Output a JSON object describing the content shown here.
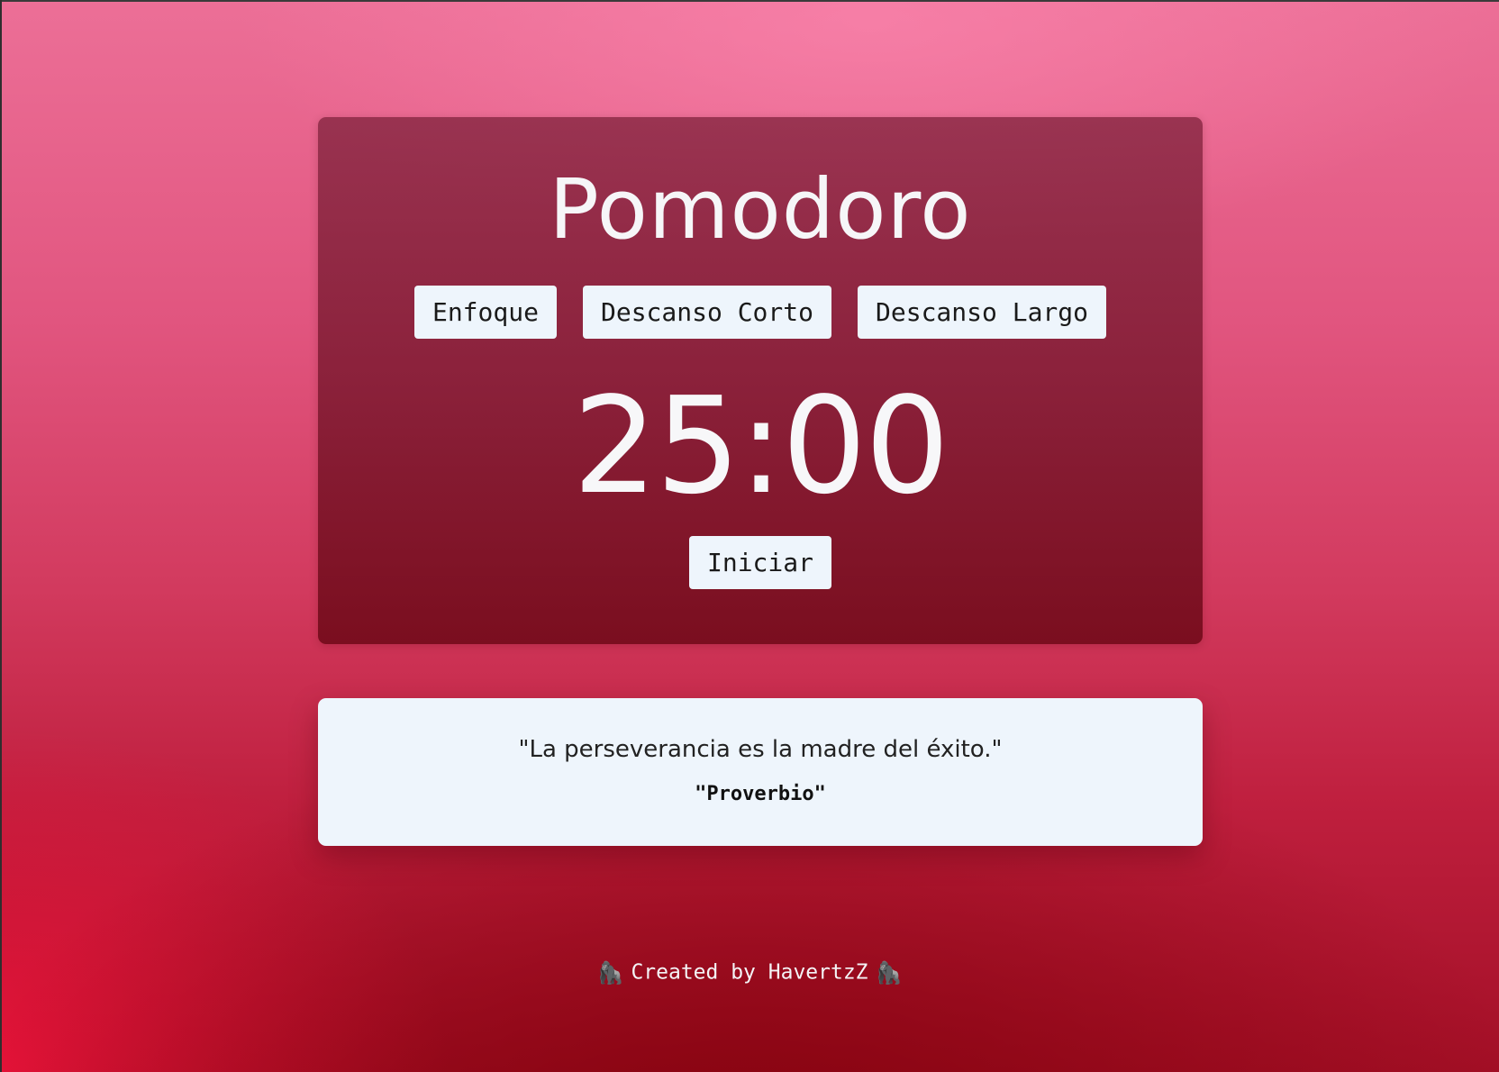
{
  "app": {
    "title": "Pomodoro"
  },
  "modes": {
    "focus_label": "Enfoque",
    "short_break_label": "Descanso Corto",
    "long_break_label": "Descanso Largo"
  },
  "timer": {
    "display": "25:00",
    "start_label": "Iniciar"
  },
  "quote": {
    "text": "\"La perseverancia es la madre del éxito.\"",
    "author": "\"Proverbio\""
  },
  "footer": {
    "emoji_left": "🦍",
    "text": "Created by HavertzZ",
    "emoji_right": "🦍"
  },
  "colors": {
    "card_bg": "#8a2440",
    "button_bg": "#eef5fc",
    "quote_bg": "#eef5fc",
    "text_light": "#f6f6f8",
    "background_top": "#ec6f97",
    "background_bottom": "#a30f26"
  }
}
